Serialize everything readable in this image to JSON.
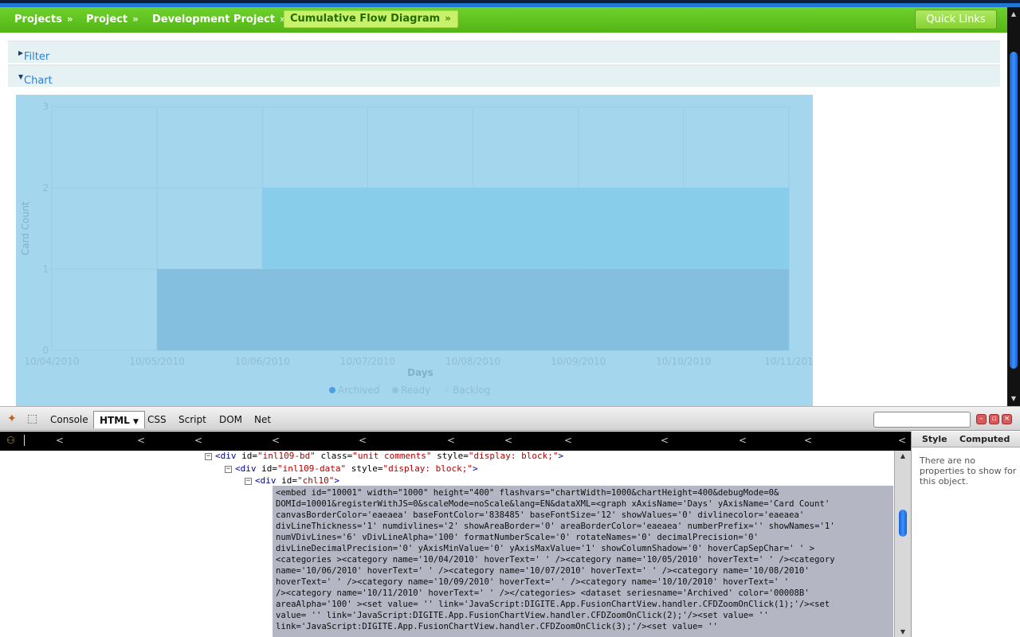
{
  "breadcrumb": {
    "items": [
      {
        "label": "Projects"
      },
      {
        "label": "Project"
      },
      {
        "label": "Development Project"
      },
      {
        "label": "Cumulative Flow Diagram"
      }
    ],
    "separator": "»",
    "quick_links": "Quick Links"
  },
  "panels": {
    "filter": "Filter",
    "chart": "Chart"
  },
  "chart_data": {
    "type": "area",
    "categories": [
      "10/04/2010",
      "10/05/2010",
      "10/06/2010",
      "10/07/2010",
      "10/08/2010",
      "10/09/2010",
      "10/10/2010",
      "10/11/201"
    ],
    "series": [
      {
        "name": "Archived",
        "values": [
          0,
          0,
          1,
          1,
          1,
          1,
          1,
          1
        ]
      },
      {
        "name": "Ready",
        "values": [
          0,
          0,
          0,
          1,
          1,
          1,
          1,
          1
        ]
      },
      {
        "name": "Backlog",
        "values": [
          0,
          0,
          0,
          0,
          0,
          0,
          0,
          0
        ]
      }
    ],
    "y_ticks": [
      "0",
      "1",
      "2",
      "3"
    ],
    "ylim": [
      0,
      3
    ],
    "xlabel": "Days",
    "ylabel": "Card Count",
    "grid": true,
    "legend": "bottom",
    "colors": {
      "background": "#a4d7ee",
      "archived": "#85bfdf",
      "ready": "#88cde9",
      "legend_archived": "#4f9ee0",
      "legend_ready": "#8fc4dd",
      "legend_backlog": "#9fd4ec"
    }
  },
  "firebug": {
    "tabs": [
      "Console",
      "HTML",
      "CSS",
      "Script",
      "DOM",
      "Net"
    ],
    "selected_tab": "HTML",
    "search_placeholder": "",
    "crumb_markers": [
      "<",
      "<",
      "<",
      "<",
      "<",
      "<",
      "<",
      "<",
      "<",
      "<",
      "<",
      "<"
    ],
    "side_tabs": [
      "Style",
      "Computed"
    ],
    "side_message": "There are no properties to show for this object.",
    "html_lines": [
      {
        "toggle": "−",
        "tag": "div",
        "attrs": [
          {
            "name": "id",
            "value": "inl109-bd"
          },
          {
            "name": "class",
            "value": "unit comments"
          },
          {
            "name": "style",
            "value": "display: block;"
          }
        ]
      },
      {
        "toggle": "−",
        "tag": "div",
        "attrs": [
          {
            "name": "id",
            "value": "inl109-data"
          },
          {
            "name": "style",
            "value": "display: block;"
          }
        ]
      },
      {
        "toggle": "−",
        "tag": "div",
        "attrs": [
          {
            "name": "id",
            "value": "chl10"
          }
        ]
      }
    ],
    "embed_text": "<embed id=\"10001\" width=\"1000\" height=\"400\" flashvars=\"chartWidth=1000&chartHeight=400&debugMode=0&\nDOMId=10001&registerWithJS=0&scaleMode=noScale&lang=EN&dataXML=<graph xAxisName='Days' yAxisName='Card Count'\ncanvasBorderColor='eaeaea' baseFontColor='838485' baseFontSize='12' showValues='0' divlinecolor='eaeaea'\ndivLineThickness='1' numdivlines='2' showAreaBorder='0' areaBorderColor='eaeaea' numberPrefix='' showNames='1'\nnumVDivLines='6' vDivLineAlpha='100' formatNumberScale='0' rotateNames='0' decimalPrecision='0'\ndivLineDecimalPrecision='0' yAxisMinValue='0' yAxisMaxValue='1' showColumnShadow='0' hoverCapSepChar=' ' >\n<categories ><category name='10/04/2010' hoverText=' ' /><category name='10/05/2010' hoverText=' ' /><category\nname='10/06/2010' hoverText=' ' /><category name='10/07/2010' hoverText=' ' /><category name='10/08/2010'\nhoverText=' ' /><category name='10/09/2010' hoverText=' ' /><category name='10/10/2010' hoverText=' '\n/><category name='10/11/2010' hoverText=' ' /></categories> <dataset seriesname='Archived' color='00008B'\nareaAlpha='100' ><set value= '' link='JavaScript:DIGITE.App.FusionChartView.handler.CFDZoomOnClick(1);'/><set\nvalue= '' link='JavaScript:DIGITE.App.FusionChartView.handler.CFDZoomOnClick(2);'/><set value= ''\nlink='JavaScript:DIGITE.App.FusionChartView.handler.CFDZoomOnClick(3);'/><set value= ''"
  }
}
